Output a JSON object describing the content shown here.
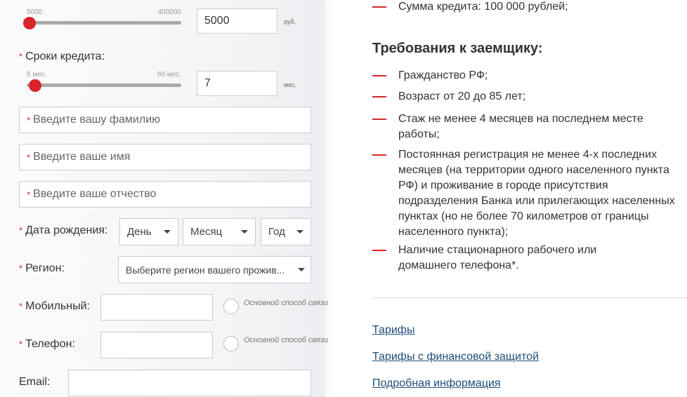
{
  "amount": {
    "min_label": "5000",
    "max_label": "400000",
    "value": "5000",
    "unit": "руб.",
    "slider_value": 5000,
    "slider_min": 5000,
    "slider_max": 400000
  },
  "term": {
    "label": "Сроки кредита:",
    "min_label": "5 мес.",
    "max_label": "60 мес.",
    "value": "7",
    "unit": "мес.",
    "slider_value": 7,
    "slider_min": 5,
    "slider_max": 60
  },
  "required_mark": "*",
  "form": {
    "surname_placeholder": "Введите вашу фамилию",
    "name_placeholder": "Введите ваше имя",
    "patronymic_placeholder": "Введите ваше отчество",
    "birth_label": "Дата рождения:",
    "day": "День",
    "month": "Месяц",
    "year": "Год",
    "region_label": "Регион:",
    "region_value": "Выберите регион вашего прожив...",
    "mobile_label": "Мобильный:",
    "phone_label": "Телефон:",
    "primary_contact": "Основной способ связи",
    "email_label": "Email:"
  },
  "right": {
    "top_item": "Сумма кредита: 100 000 рублей;",
    "heading": "Требования к заемщику:",
    "items": [
      "Гражданство РФ;",
      "Возраст от 20 до 85 лет;",
      "Стаж не менее 4 месяцев на последнем месте работы;",
      "Постоянная регистрация не менее 4-х последних месяцев (на территории одного населенного пункта РФ) и проживание в городе присутствия подразделения Банка или прилегающих населенных пунктах (но не более 70 километров от границы населенного пункта);",
      "Наличие стационарного рабочего или домашнего телефона*."
    ],
    "links": [
      "Тарифы",
      "Тарифы с финансовой защитой",
      "Подробная информация"
    ]
  },
  "colors": {
    "accent": "#d9252a",
    "link": "#1f4e79"
  }
}
